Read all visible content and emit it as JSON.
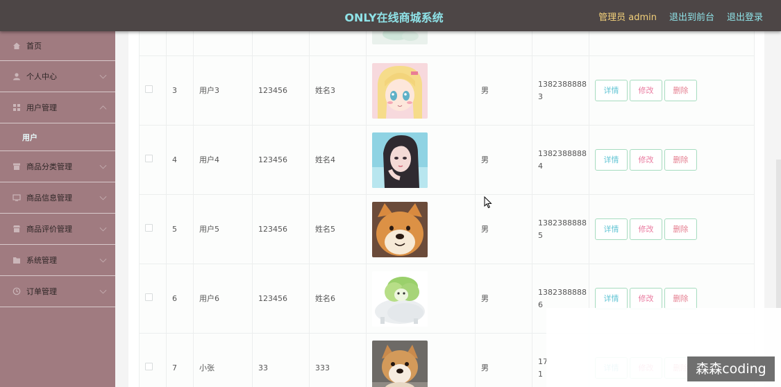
{
  "header": {
    "title": "ONLY在线商城系统",
    "admin_label": "管理员 admin",
    "frontend_link": "退出到前台",
    "logout_link": "退出登录"
  },
  "sidebar": {
    "items": [
      {
        "label": "首页",
        "icon": "home-icon"
      },
      {
        "label": "个人中心",
        "icon": "user-icon"
      },
      {
        "label": "用户管理",
        "icon": "grid-icon",
        "expanded": true,
        "sub": "用户"
      },
      {
        "label": "商品分类管理",
        "icon": "archive-icon"
      },
      {
        "label": "商品信息管理",
        "icon": "screen-icon"
      },
      {
        "label": "商品评价管理",
        "icon": "store-icon"
      },
      {
        "label": "系统管理",
        "icon": "folder-icon"
      },
      {
        "label": "订单管理",
        "icon": "clock-icon"
      }
    ]
  },
  "table": {
    "actions": {
      "detail": "详情",
      "edit": "修改",
      "delete": "删除"
    },
    "rows": [
      {
        "index": "3",
        "username": "用户3",
        "password": "123456",
        "name": "姓名3",
        "avatar": "anime-girl-blonde",
        "gender": "男",
        "phone_line1": "1382388888",
        "phone_line2": "3"
      },
      {
        "index": "4",
        "username": "用户4",
        "password": "123456",
        "name": "姓名4",
        "avatar": "girl-portrait",
        "gender": "男",
        "phone_line1": "1382388888",
        "phone_line2": "4"
      },
      {
        "index": "5",
        "username": "用户5",
        "password": "123456",
        "name": "姓名5",
        "avatar": "shiba-dog",
        "gender": "男",
        "phone_line1": "1382388888",
        "phone_line2": "5"
      },
      {
        "index": "6",
        "username": "用户6",
        "password": "123456",
        "name": "姓名6",
        "avatar": "cabbage-dog",
        "gender": "男",
        "phone_line1": "1382388888",
        "phone_line2": "6"
      },
      {
        "index": "7",
        "username": "小张",
        "password": "33",
        "name": "333",
        "avatar": "shiba-puppy",
        "gender": "男",
        "phone_line1": "17",
        "phone_line2": "1"
      }
    ]
  },
  "watermark": "森森coding",
  "colors": {
    "header_bg": "#4d4646",
    "sidebar_bg": "#a07b80",
    "title": "#8fe3e8",
    "admin": "#f2d07a"
  }
}
